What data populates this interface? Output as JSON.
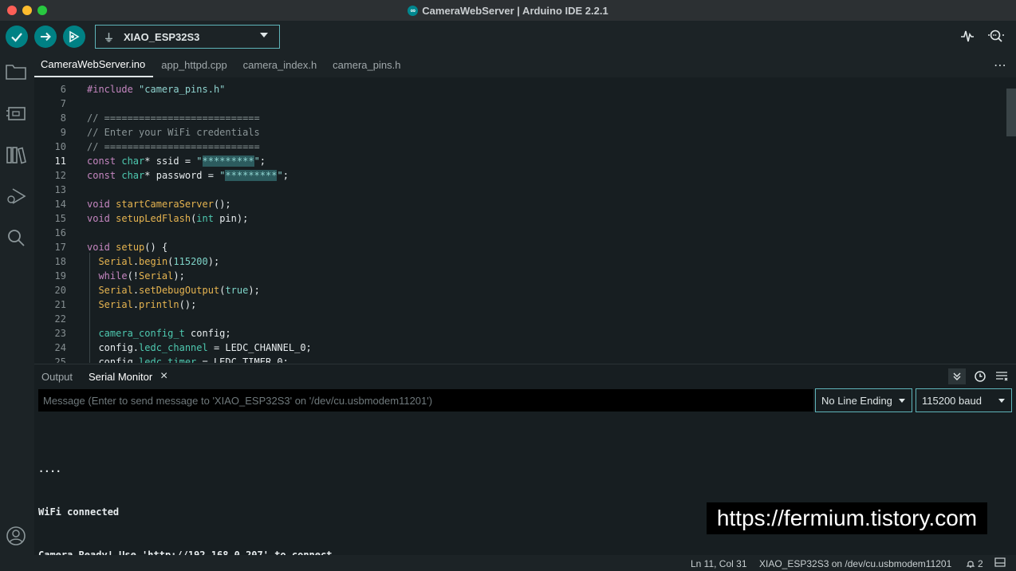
{
  "window": {
    "title": "CameraWebServer | Arduino IDE 2.2.1"
  },
  "toolbar": {
    "verify_icon": "check-icon",
    "upload_icon": "arrow-right-icon",
    "debug_icon": "debug-icon",
    "board": "XIAO_ESP32S3",
    "usb_icon": "usb-icon",
    "plotter_icon": "serial-plotter-icon",
    "monitor_icon": "serial-monitor-icon"
  },
  "tabs": [
    {
      "label": "CameraWebServer.ino",
      "active": true
    },
    {
      "label": "app_httpd.cpp",
      "active": false
    },
    {
      "label": "camera_index.h",
      "active": false
    },
    {
      "label": "camera_pins.h",
      "active": false
    }
  ],
  "tabs_more": "⋯",
  "editor": {
    "current_line": 11,
    "lines": [
      {
        "n": "6",
        "code": "#include \"camera_pins.h\""
      },
      {
        "n": "7",
        "code": ""
      },
      {
        "n": "8",
        "code": "// ==========================="
      },
      {
        "n": "9",
        "code": "// Enter your WiFi credentials"
      },
      {
        "n": "10",
        "code": "// ==========================="
      },
      {
        "n": "11",
        "code": "const char* ssid = \"*********\";"
      },
      {
        "n": "12",
        "code": "const char* password = \"*********\";"
      },
      {
        "n": "13",
        "code": ""
      },
      {
        "n": "14",
        "code": "void startCameraServer();"
      },
      {
        "n": "15",
        "code": "void setupLedFlash(int pin);"
      },
      {
        "n": "16",
        "code": ""
      },
      {
        "n": "17",
        "code": "void setup() {"
      },
      {
        "n": "18",
        "code": "  Serial.begin(115200);"
      },
      {
        "n": "19",
        "code": "  while(!Serial);"
      },
      {
        "n": "20",
        "code": "  Serial.setDebugOutput(true);"
      },
      {
        "n": "21",
        "code": "  Serial.println();"
      },
      {
        "n": "22",
        "code": ""
      },
      {
        "n": "23",
        "code": "  camera_config_t config;"
      },
      {
        "n": "24",
        "code": "  config.ledc_channel = LEDC_CHANNEL_0;"
      },
      {
        "n": "25",
        "code": "  config.ledc_timer = LEDC_TIMER_0;"
      }
    ]
  },
  "panel": {
    "tab_output": "Output",
    "tab_serial": "Serial Monitor",
    "close": "×",
    "message_placeholder": "Message (Enter to send message to 'XIAO_ESP32S3' on '/dev/cu.usbmodem11201')",
    "line_ending": "No Line Ending",
    "baud": "115200 baud",
    "output_lines": [
      "....",
      "WiFi connected",
      "Camera Ready! Use 'http://192.168.0.207' to connect"
    ]
  },
  "watermark": "https://fermium.tistory.com",
  "statusbar": {
    "position": "Ln 11, Col 31",
    "board_port": "XIAO_ESP32S3 on /dev/cu.usbmodem11201",
    "notifications": "2"
  },
  "colors": {
    "accent": "#008184",
    "board_border": "#5fb4b9",
    "background": "#171e21"
  }
}
